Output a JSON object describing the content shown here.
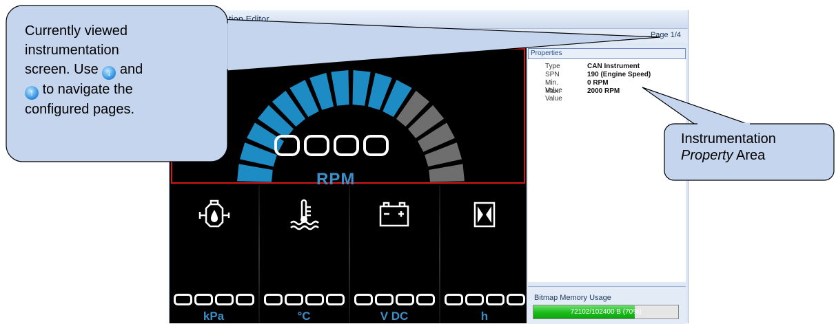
{
  "window": {
    "title_partial": "tion Editor",
    "page_indicator": "Page 1/4"
  },
  "display": {
    "main_gauge": {
      "digits": "0000",
      "unit": "RPM",
      "max_value": 2000,
      "segments_total": 16,
      "segments_active": 11,
      "active_color": "#1e8cc4",
      "inactive_color": "#6e6e6e",
      "frame_color": "#d01a1a"
    },
    "cells": [
      {
        "icon": "oil-pressure-icon",
        "digits": "0000",
        "unit": "kPa"
      },
      {
        "icon": "coolant-temperature-icon",
        "digits": "0000",
        "unit": "°C"
      },
      {
        "icon": "battery-icon",
        "digits": "0000",
        "unit": "V DC"
      },
      {
        "icon": "hourglass-icon",
        "digits": "0000",
        "unit": "h"
      }
    ],
    "unit_color": "#3a8fc9"
  },
  "properties": {
    "header": "Properties",
    "rows": [
      {
        "key": "Type",
        "value": "CAN Instrument"
      },
      {
        "key": "SPN",
        "value": "190 (Engine Speed)"
      },
      {
        "key": "Min. Value",
        "value": "0 RPM"
      },
      {
        "key": "Max. Value",
        "value": "2000 RPM"
      }
    ]
  },
  "memory": {
    "label": "Bitmap Memory Usage",
    "value_text": "72102/102400 B (70%)",
    "fraction": 0.7
  },
  "callouts": {
    "left": {
      "line1": "Currently viewed",
      "line2": "instrumentation",
      "line3_pre": "screen. Use",
      "line3_post": "and",
      "line4": "to navigate the",
      "line5": "configured pages."
    },
    "right": {
      "line1": "Instrumentation",
      "line2_italic": "Property",
      "line2_rest": "Area"
    }
  }
}
